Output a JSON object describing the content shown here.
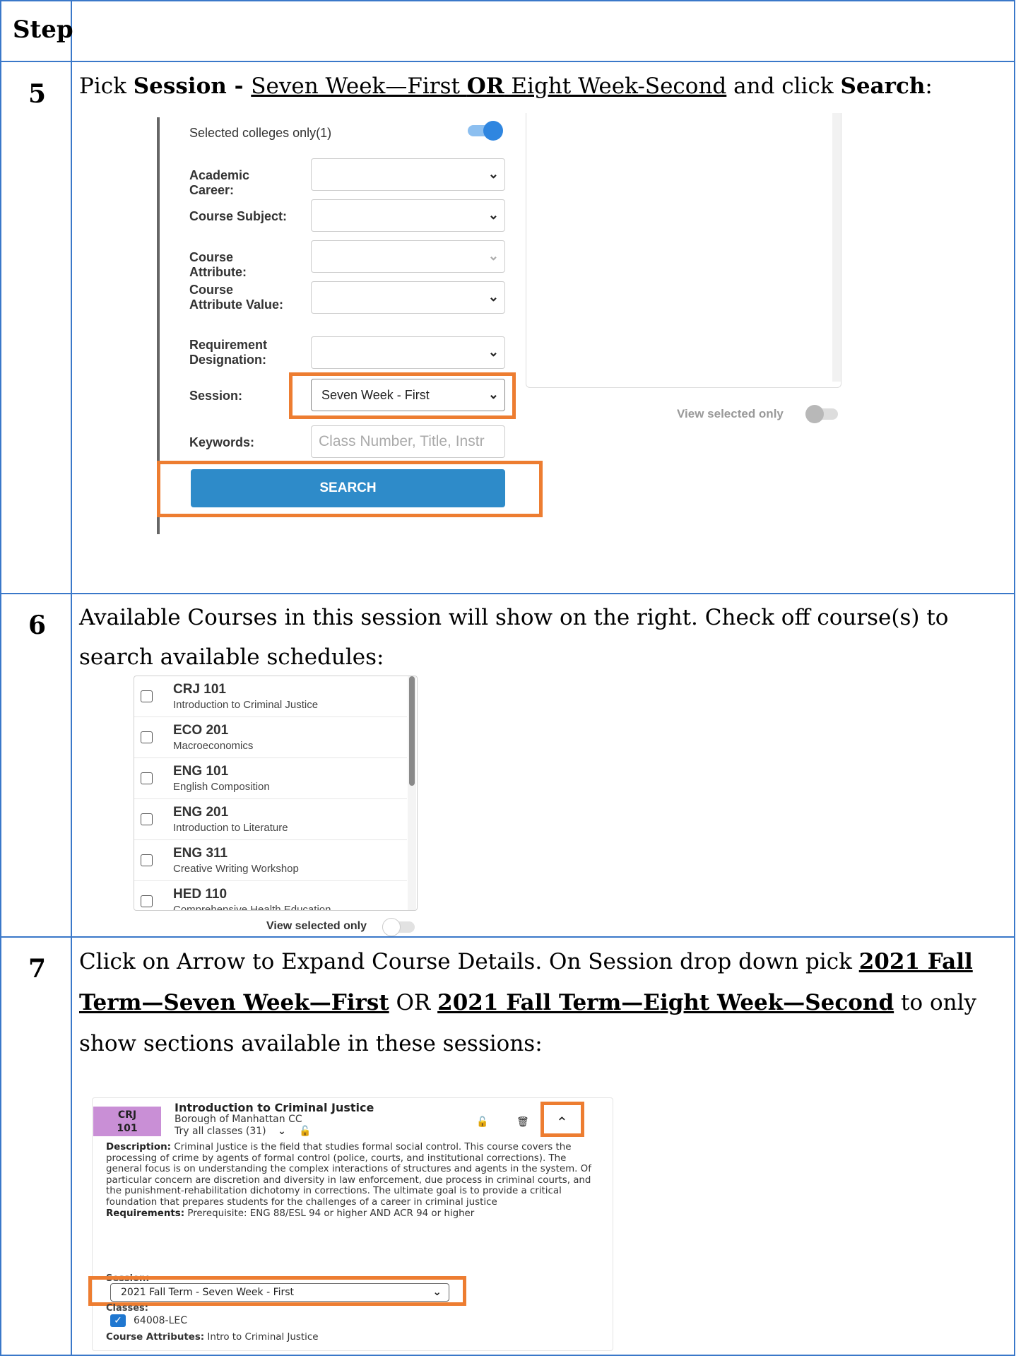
{
  "header": {
    "step_label": "Step"
  },
  "rows": [
    {
      "number": "5",
      "instruction": {
        "pre": "Pick ",
        "bold1": "Session - ",
        "under1": "Seven Week—First ",
        "under_bold": "OR",
        "under2": " Eight Week-Second",
        "mid": " and click ",
        "bold2": "Search",
        "post": ":"
      }
    },
    {
      "number": "6",
      "instruction": "Available Courses in this session will show on the right. Check off course(s) to search available schedules:"
    },
    {
      "number": "7",
      "instruction": {
        "pre": "Click on Arrow to Expand Course Details. On Session drop down pick ",
        "opt1": "2021 Fall Term—Seven Week—First",
        "or": " OR ",
        "opt2": "2021 Fall Term—Eight Week—Second",
        "post": " to only show sections available in these sessions:"
      }
    }
  ],
  "search_form": {
    "selected_colleges": "Selected colleges only(1)",
    "academic_career_label": "Academic Career:",
    "course_subject_label": "Course Subject:",
    "course_attribute_label": "Course Attribute:",
    "course_attribute_value_label": "Course Attribute Value:",
    "requirement_designation_label": "Requirement Designation:",
    "session_label": "Session:",
    "session_value": "Seven Week - First",
    "keywords_label": "Keywords:",
    "keywords_placeholder": "Class Number, Title, Instr",
    "search_button": "SEARCH",
    "view_selected_only": "View selected only"
  },
  "course_list": {
    "items": [
      {
        "code": "CRJ 101",
        "title": "Introduction to Criminal Justice"
      },
      {
        "code": "ECO 201",
        "title": "Macroeconomics"
      },
      {
        "code": "ENG 101",
        "title": "English Composition"
      },
      {
        "code": "ENG 201",
        "title": "Introduction to Literature"
      },
      {
        "code": "ENG 311",
        "title": "Creative Writing Workshop"
      },
      {
        "code": "HED 110",
        "title": "Comprehensive Health Education"
      }
    ],
    "view_selected_only": "View selected only"
  },
  "course_card": {
    "badge_line1": "CRJ",
    "badge_line2": "101",
    "title": "Introduction to Criminal Justice",
    "college": "Borough of Manhattan CC",
    "try_all": "Try all classes (31)",
    "description_label": "Description:",
    "description": " Criminal Justice is the field that studies formal social control. This course covers the processing of crime by agents of formal control (police, courts, and institutional corrections). The general focus is on understanding the complex interactions of structures and agents in the system. Of particular concern are discretion and diversity in law enforcement, due process in criminal courts, and the punishment-rehabilitation dichotomy in corrections. The ultimate goal is to provide a critical foundation that prepares students for the challenges of a career in criminal justice",
    "requirements_label": "Requirements:",
    "requirements": " Prerequisite: ENG 88/ESL 94 or higher AND ACR 94 or higher",
    "session_label": "Session:",
    "session_value": "2021 Fall Term - Seven Week - First",
    "classes_label": "Classes:",
    "class_id": "64008-LEC",
    "attributes_label": "Course Attributes:",
    "attributes": " Intro to Criminal Justice"
  },
  "colors": {
    "table_border": "#3a78c9",
    "highlight": "#ed7d31",
    "search_button": "#2e8bc9",
    "badge": "#c98fd6"
  }
}
